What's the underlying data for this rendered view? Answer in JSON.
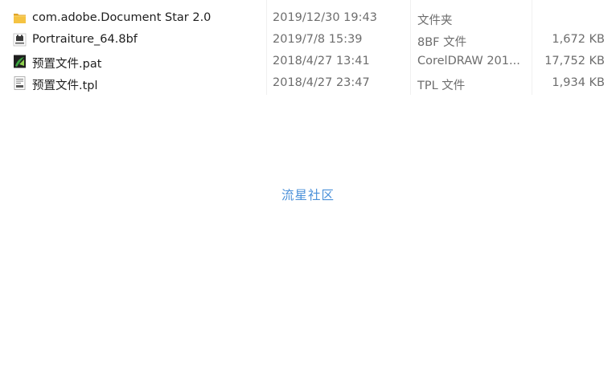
{
  "files": [
    {
      "icon": "folder-icon",
      "name": "com.adobe.Document Star 2.0",
      "date": "2019/12/30 19:43",
      "type": "文件夹",
      "size": ""
    },
    {
      "icon": "8bf-plugin-icon",
      "name": "Portraiture_64.8bf",
      "date": "2019/7/8 15:39",
      "type": "8BF 文件",
      "size": "1,672 KB"
    },
    {
      "icon": "coreldraw-icon",
      "name": "预置文件.pat",
      "date": "2018/4/27 13:41",
      "type": "CorelDRAW 201...",
      "size": "17,752 KB"
    },
    {
      "icon": "tpl-file-icon",
      "name": "预置文件.tpl",
      "date": "2018/4/27 23:47",
      "type": "TPL 文件",
      "size": "1,934 KB"
    }
  ],
  "watermark": "流星社区",
  "colors": {
    "folder": "#f5c342",
    "folder_dark": "#e0a528",
    "watermark": "#4a90d9",
    "corel_green": "#3aa340"
  }
}
